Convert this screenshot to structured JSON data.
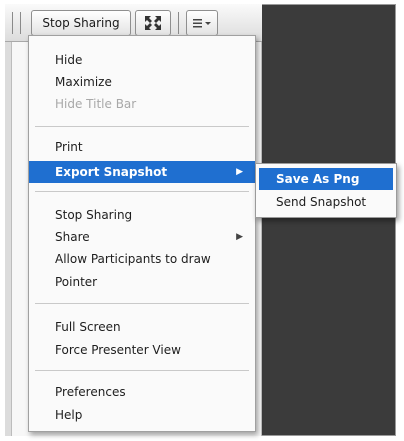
{
  "toolbar": {
    "stop_sharing_label": "Stop Sharing",
    "fullscreen_icon": "expand-arrows-icon",
    "menu_icon": "hamburger-menu-icon"
  },
  "menu": {
    "items": [
      {
        "label": "Hide",
        "enabled": true
      },
      {
        "label": "Maximize",
        "enabled": true
      },
      {
        "label": "Hide Title Bar",
        "enabled": false
      },
      {
        "label": "Print",
        "enabled": true
      },
      {
        "label": "Export Snapshot",
        "enabled": true,
        "highlighted": true,
        "has_submenu": true
      },
      {
        "label": "Stop Sharing",
        "enabled": true
      },
      {
        "label": "Share",
        "enabled": true,
        "has_submenu": true
      },
      {
        "label": "Allow Participants to draw",
        "enabled": true
      },
      {
        "label": "Pointer",
        "enabled": true
      },
      {
        "label": "Full Screen",
        "enabled": true
      },
      {
        "label": "Force Presenter View",
        "enabled": true
      },
      {
        "label": "Preferences",
        "enabled": true
      },
      {
        "label": "Help",
        "enabled": true
      }
    ]
  },
  "submenu": {
    "items": [
      {
        "label": "Save As Png",
        "highlighted": true
      },
      {
        "label": "Send Snapshot",
        "highlighted": false
      }
    ]
  },
  "colors": {
    "highlight": "#1f6fd0",
    "dark_background": "#3b3b3b",
    "disabled_text": "#a8a8a8"
  }
}
